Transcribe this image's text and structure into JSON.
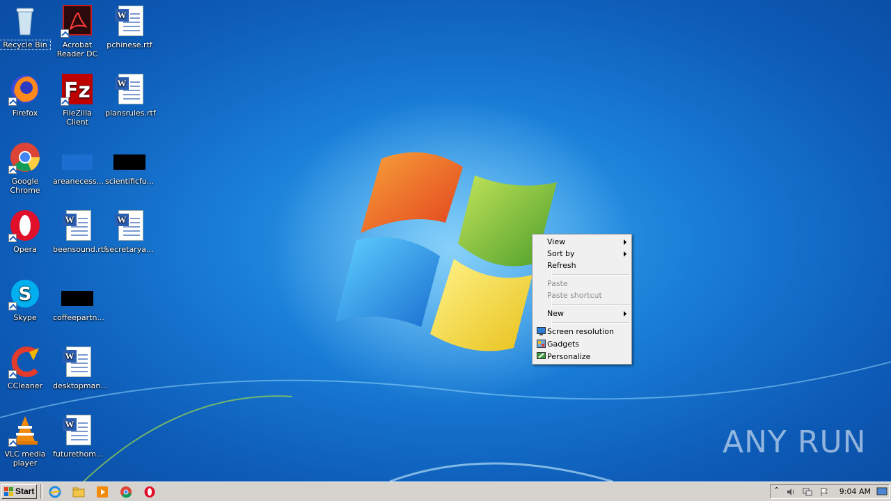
{
  "desktop": {
    "icons": [
      {
        "label": "Recycle Bin"
      },
      {
        "label": "Acrobat Reader DC"
      },
      {
        "label": "pchinese.rtf"
      },
      {
        "label": "Firefox"
      },
      {
        "label": "FileZilla Client"
      },
      {
        "label": "plansrules.rtf"
      },
      {
        "label": "Google Chrome"
      },
      {
        "label": "areanecess..."
      },
      {
        "label": "scientificfu..."
      },
      {
        "label": "Opera"
      },
      {
        "label": "beensound.rtf"
      },
      {
        "label": "secretarya..."
      },
      {
        "label": "Skype"
      },
      {
        "label": "coffeepartn..."
      },
      {
        "label": "CCleaner"
      },
      {
        "label": "desktopman..."
      },
      {
        "label": "VLC media player"
      },
      {
        "label": "futurethom..."
      }
    ]
  },
  "context_menu": {
    "view": "View",
    "sort_by": "Sort by",
    "refresh": "Refresh",
    "paste": "Paste",
    "paste_shortcut": "Paste shortcut",
    "new": "New",
    "screen_resolution": "Screen resolution",
    "gadgets": "Gadgets",
    "personalize": "Personalize"
  },
  "taskbar": {
    "start_label": "Start",
    "clock": "9:04 AM",
    "quick_launch": [
      "internet-explorer-icon",
      "explorer-folder-icon",
      "media-player-icon",
      "chrome-icon",
      "opera-icon"
    ]
  },
  "watermark": "ANY RUN"
}
